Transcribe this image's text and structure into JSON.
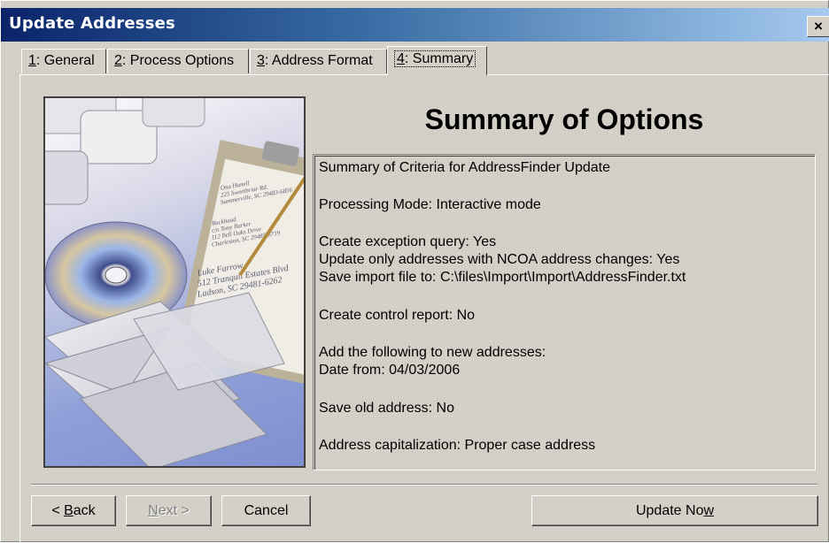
{
  "window": {
    "title": "Update Addresses",
    "close_glyph": "×"
  },
  "tabs": [
    {
      "key": "1",
      "rest": ": General",
      "active": false
    },
    {
      "key": "2",
      "rest": ": Process Options",
      "active": false
    },
    {
      "key": "3",
      "rest": ": Address Format",
      "active": false
    },
    {
      "key": "4",
      "rest": ": Summary",
      "active": true
    }
  ],
  "image": {
    "icon": "mail-clipboard-cd-illustration",
    "text_lines": [
      "Ona Hanell",
      "225 Sweetbriar Rd.",
      "Summerville, SC 29483-6856",
      "Backbaud",
      "c/o Tony Barker",
      "112 Bell Oaks Drive",
      "Charleston, SC 29485-8719",
      "Luke Farrow",
      "512 Tranquil Estates Blvd",
      "Ladson, SC 29481-6262"
    ]
  },
  "summary": {
    "heading": "Summary of Options",
    "lines": [
      "Summary of Criteria for AddressFinder Update",
      "Processing Mode:  Interactive mode",
      "Create exception query:  Yes",
      "Update only addresses with NCOA address changes:  Yes",
      "Save import file to:  C:\\files\\Import\\Import\\AddressFinder.txt",
      "Create control report:  No",
      "Add the following to new addresses:",
      "Date from:  04/03/2006",
      "Save old address:  No",
      "Address capitalization:  Proper case address"
    ]
  },
  "buttons": {
    "back": {
      "prefix": "< ",
      "key": "B",
      "rest": "ack"
    },
    "next": {
      "key": "N",
      "rest": "ext >"
    },
    "cancel": "Cancel",
    "update": {
      "prefix": "Update No",
      "key": "w",
      "rest": ""
    }
  }
}
